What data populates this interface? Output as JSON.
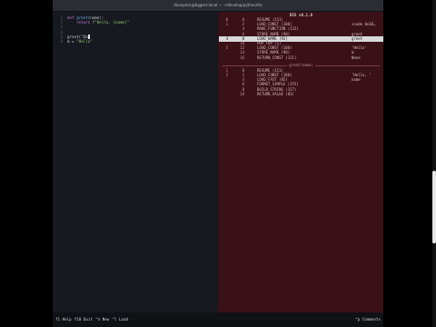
{
  "window": {
    "title": "davepeck@tiggers.local — ~/develop/python/dis"
  },
  "editor": {
    "lines": [
      {
        "num": "1",
        "tokens": [
          {
            "t": "def ",
            "c": "kw"
          },
          {
            "t": "greet",
            "c": "fn"
          },
          {
            "t": "(name):",
            "c": ""
          }
        ]
      },
      {
        "num": "2",
        "tokens": [
          {
            "t": "    return ",
            "c": "kw"
          },
          {
            "t": "f\"Hello, {name}\"",
            "c": "str"
          }
        ]
      },
      {
        "num": "3",
        "tokens": []
      },
      {
        "num": "4",
        "tokens": []
      },
      {
        "num": "5",
        "tokens": [
          {
            "t": "greet(\"Da",
            "c": ""
          }
        ],
        "cursor": true
      },
      {
        "num": "6",
        "tokens": [
          {
            "t": "m = ",
            "c": ""
          },
          {
            "t": "\"Hello\"",
            "c": "str"
          }
        ]
      }
    ]
  },
  "disassembly": {
    "header": "DIS v0.1.0",
    "rows": [
      {
        "src": "0",
        "off": "0",
        "op": "RESUME (151)",
        "val": ""
      },
      {
        "src": "1",
        "off": "2",
        "op": "LOAD_CONST (100)",
        "val": "<code 0x10…"
      },
      {
        "src": "",
        "off": "4",
        "op": "MAKE_FUNCTION (132)",
        "val": ""
      },
      {
        "src": "",
        "off": "6",
        "op": "STORE_NAME (90)",
        "val": "greet"
      },
      {
        "src": "4",
        "off": "8",
        "op": "LOAD_NAME (92)",
        "val": "greet",
        "hl": true
      },
      {
        "src": "",
        "off": "10",
        "op": "POP_TOP (1)",
        "val": ""
      },
      {
        "src": "5",
        "off": "12",
        "op": "LOAD_CONST (100)",
        "val": "'Hello'"
      },
      {
        "src": "",
        "off": "14",
        "op": "STORE_NAME (90)",
        "val": "m"
      },
      {
        "src": "",
        "off": "16",
        "op": "RETURN_CONST (121)",
        "val": "None"
      }
    ],
    "section": "greet(name)",
    "rows2": [
      {
        "src": "1",
        "off": "0",
        "op": "RESUME (151)",
        "val": ""
      },
      {
        "src": "2",
        "off": "2",
        "op": "LOAD_CONST (100)",
        "val": "'Hello, '"
      },
      {
        "src": "",
        "off": "4",
        "op": "LOAD_FAST (85)",
        "val": "name"
      },
      {
        "src": "",
        "off": "6",
        "op": "FORMAT_SIMPLE (155)",
        "val": ""
      },
      {
        "src": "",
        "off": "8",
        "op": "BUILD_STRING (157)",
        "val": ""
      },
      {
        "src": "",
        "off": "10",
        "op": "RETURN_VALUE (83)",
        "val": ""
      }
    ]
  },
  "status": {
    "left": [
      {
        "key": "f1",
        "label": "Help"
      },
      {
        "key": "f10",
        "label": "Quit"
      },
      {
        "key": "^n",
        "label": "New"
      },
      {
        "key": "^l",
        "label": "Load"
      }
    ],
    "right": {
      "key": "^p",
      "label": "Comments"
    }
  },
  "colors": {
    "accent": "#3b1118",
    "editor_bg": "#16191f",
    "highlight": "#d9d9d9"
  }
}
